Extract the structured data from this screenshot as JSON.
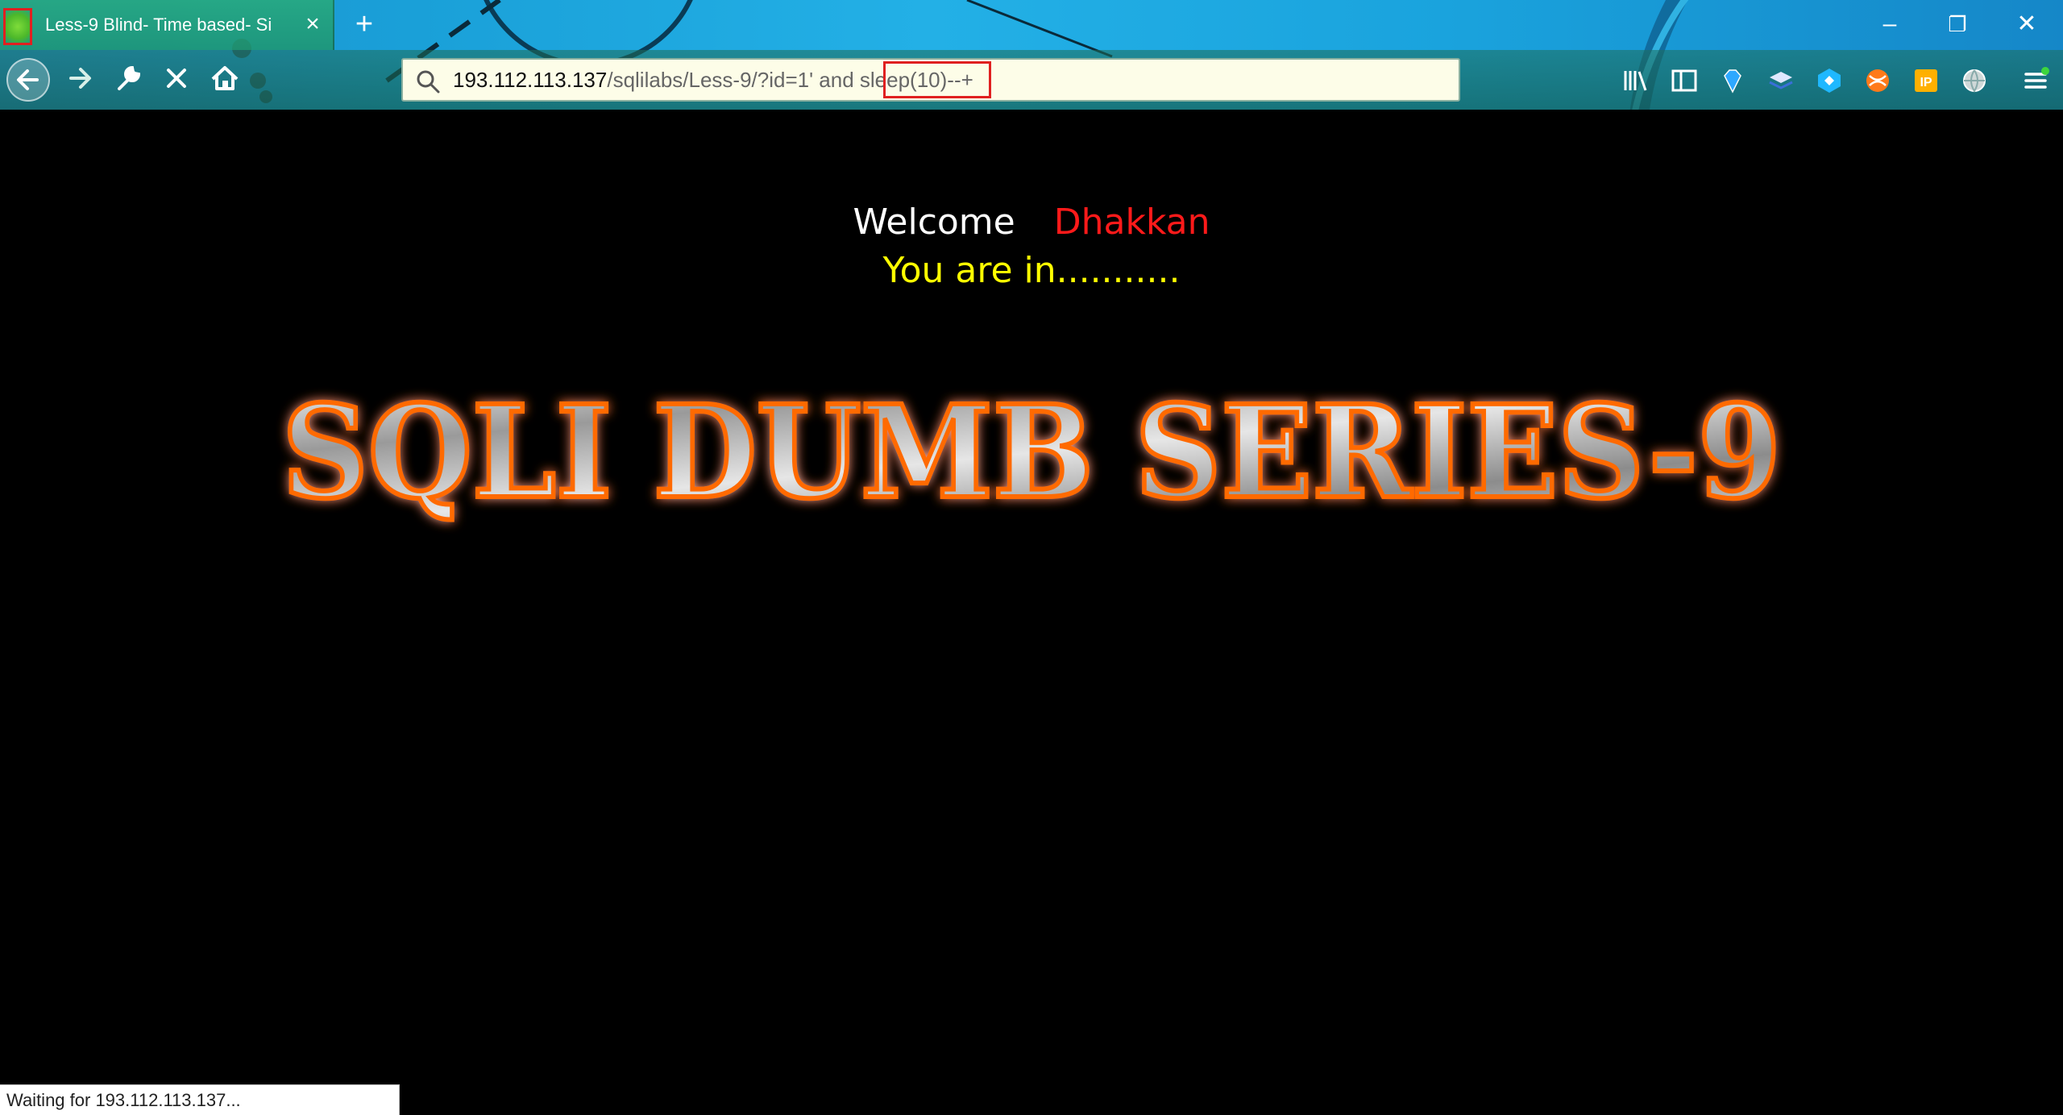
{
  "browser": {
    "tab": {
      "title": "Less-9 Blind- Time based- Si",
      "close_icon": "close-icon"
    },
    "new_tab_label": "+",
    "window_controls": {
      "minimize": "–",
      "restore": "❐",
      "close": "✕"
    },
    "nav": {
      "back_icon": "back-arrow-icon",
      "forward_icon": "forward-arrow-icon",
      "tools_icon": "wrench-icon",
      "stop_icon": "stop-icon",
      "home_icon": "home-icon"
    },
    "address_bar": {
      "host": "193.112.113.137",
      "path": "/sqlilabs/Less-9/?id=1' and sleep(10)--+",
      "highlighted_segment": "sleep(10)"
    },
    "toolbar_icons": [
      "library-icon",
      "sidebar-icon",
      "gem-icon",
      "layers-icon",
      "cube-icon",
      "ball-icon",
      "ip-icon",
      "globe-icon",
      "menu-icon"
    ]
  },
  "page": {
    "welcome": "Welcome",
    "user_name": "Dhakkan",
    "status": "You are in...........",
    "banner": "SQLI DUMB SERIES-9"
  },
  "status_bar": {
    "text": "Waiting for 193.112.113.137..."
  },
  "colors": {
    "page_background": "#000000",
    "welcome_text": "#ffffff",
    "user_name": "#ff1a1a",
    "status_text": "#ffff00",
    "banner_glow": "#ff6a00",
    "highlight_box": "#e02020"
  }
}
